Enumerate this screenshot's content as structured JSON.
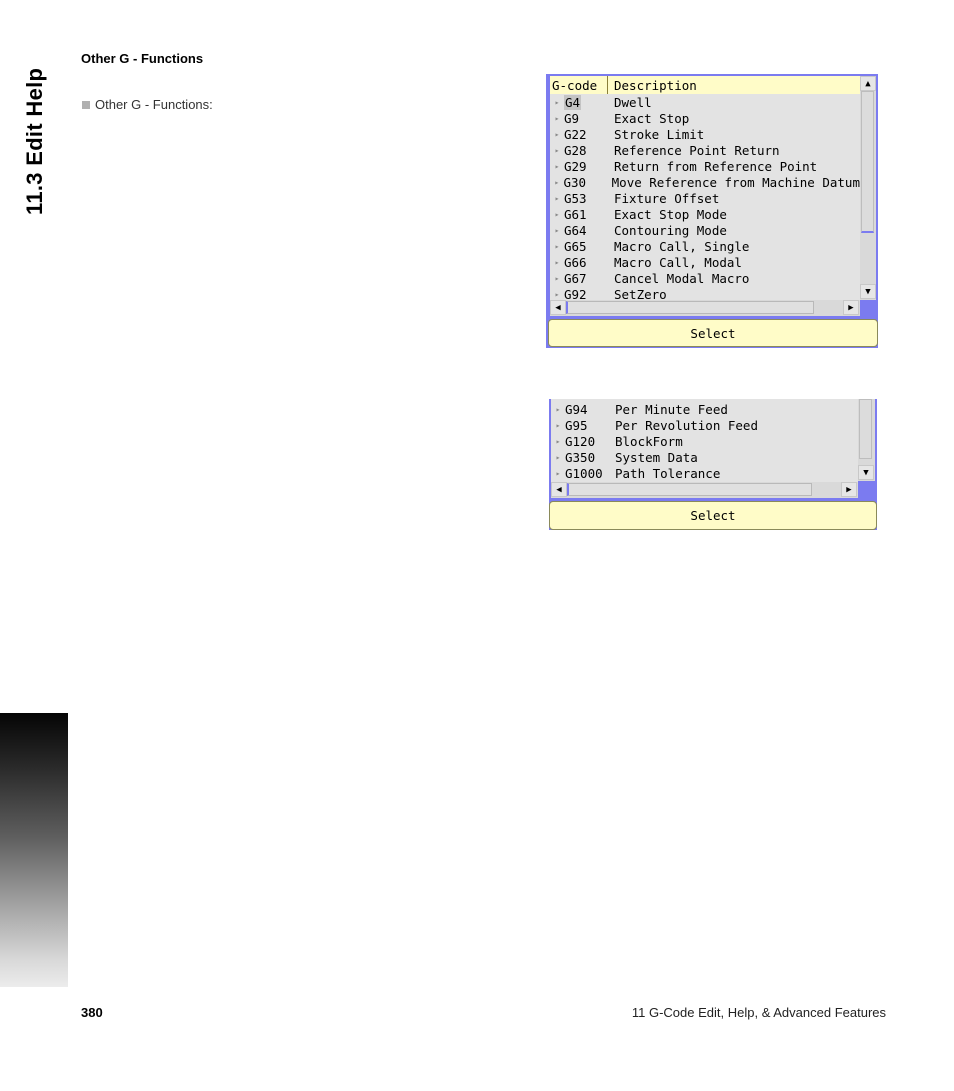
{
  "side_tab": {
    "title": "11.3 Edit Help"
  },
  "section": {
    "heading": "Other G - Functions",
    "bullet": "Other G - Functions:"
  },
  "panel1": {
    "columns": [
      "G-code",
      "Description"
    ],
    "rows": [
      {
        "code": "G4",
        "desc": "Dwell",
        "selected": true
      },
      {
        "code": "G9",
        "desc": "Exact Stop"
      },
      {
        "code": "G22",
        "desc": "Stroke Limit"
      },
      {
        "code": "G28",
        "desc": "Reference Point Return"
      },
      {
        "code": "G29",
        "desc": "Return from Reference Point"
      },
      {
        "code": "G30",
        "desc": "Move Reference from Machine Datum"
      },
      {
        "code": "G53",
        "desc": "Fixture Offset"
      },
      {
        "code": "G61",
        "desc": "Exact Stop Mode"
      },
      {
        "code": "G64",
        "desc": "Contouring Mode"
      },
      {
        "code": "G65",
        "desc": "Macro Call, Single"
      },
      {
        "code": "G66",
        "desc": "Macro Call, Modal"
      },
      {
        "code": "G67",
        "desc": "Cancel Modal Macro"
      },
      {
        "code": "G92",
        "desc": "SetZero"
      }
    ],
    "select_label": "Select",
    "icons": {
      "up": "triangle-up-icon",
      "down": "triangle-down-icon",
      "left": "triangle-left-icon",
      "right": "triangle-right-icon"
    }
  },
  "panel2": {
    "rows": [
      {
        "code": "G94",
        "desc": "Per Minute Feed"
      },
      {
        "code": "G95",
        "desc": "Per Revolution Feed"
      },
      {
        "code": "G120",
        "desc": "BlockForm"
      },
      {
        "code": "G350",
        "desc": "System Data"
      },
      {
        "code": "G1000",
        "desc": "Path Tolerance"
      }
    ],
    "select_label": "Select"
  },
  "footer": {
    "page_number": "380",
    "chapter": "11 G-Code Edit, Help, & Advanced Features"
  },
  "colors": {
    "panel_frame": "#7b7bf0",
    "header_bg": "#fffcc8",
    "list_bg": "#e3e3e3"
  }
}
